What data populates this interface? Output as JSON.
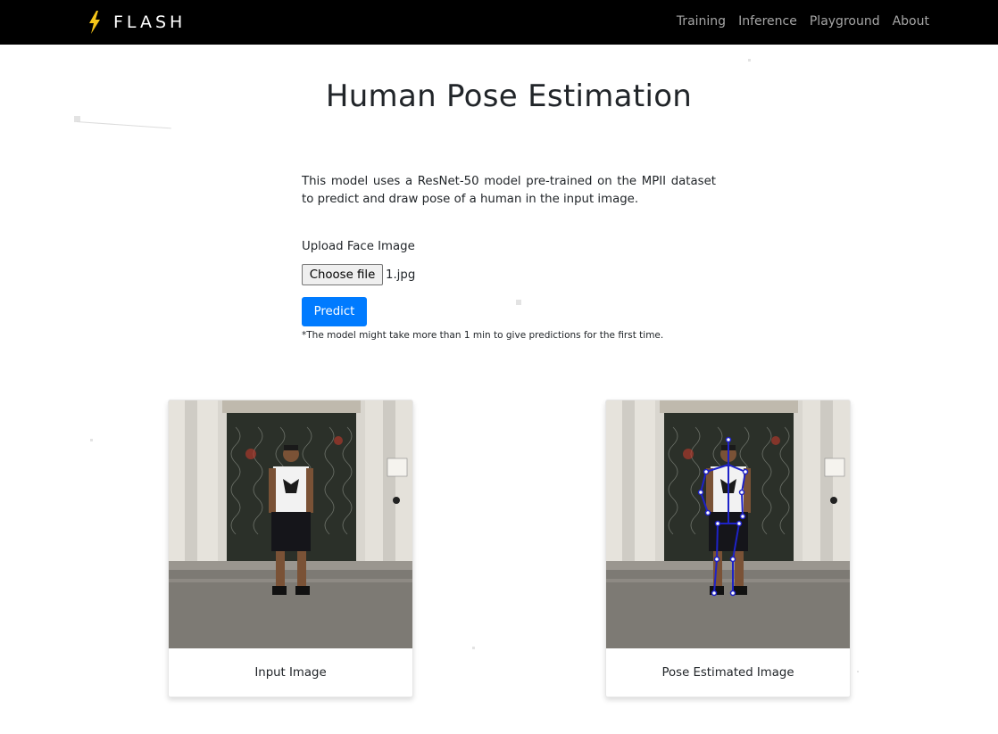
{
  "navbar": {
    "brand": "FLASH",
    "brand_icon": "lightning-bolt-icon",
    "links": [
      "Training",
      "Inference",
      "Playground",
      "About"
    ]
  },
  "main": {
    "title": "Human Pose Estimation",
    "description": "This model uses a ResNet-50 model pre-trained on the MPII dataset to predict and draw pose of a human in the input image.",
    "upload_label": "Upload Face Image",
    "choose_file_label": "Choose file",
    "file_name": "1.jpg",
    "predict_label": "Predict",
    "note": "*The model might take more than 1 min to give predictions for the first time."
  },
  "results": {
    "input_caption": "Input Image",
    "output_caption": "Pose Estimated Image"
  },
  "colors": {
    "navbar_bg": "#000000",
    "bolt": "#f5c518",
    "primary_button": "#007bff",
    "skeleton": "#1e22c8"
  }
}
